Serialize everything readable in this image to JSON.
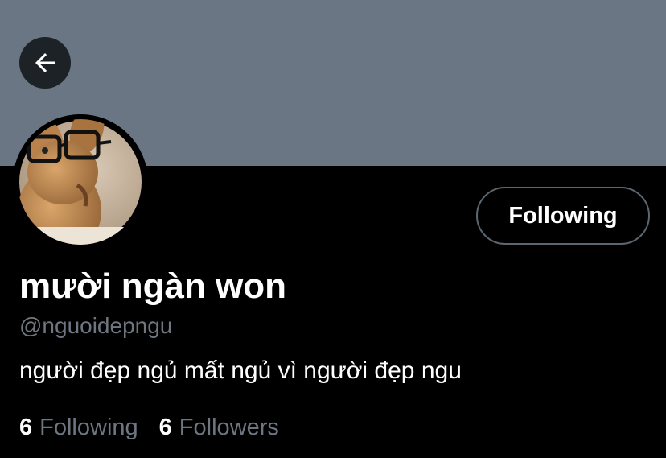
{
  "header": {
    "banner_color": "#6a7683",
    "back_icon": "arrow-left-icon"
  },
  "profile": {
    "avatar": "rabbit-with-glasses",
    "follow_button_label": "Following",
    "display_name": "mười ngàn won",
    "handle": "@nguoidepngu",
    "bio": "người đẹp ngủ mất ngủ vì người đẹp ngu"
  },
  "stats": {
    "following_count": "6",
    "following_label": "Following",
    "followers_count": "6",
    "followers_label": "Followers"
  },
  "colors": {
    "background": "#000000",
    "text": "#ffffff",
    "muted": "#6e7781",
    "button_border": "#5b6670"
  }
}
